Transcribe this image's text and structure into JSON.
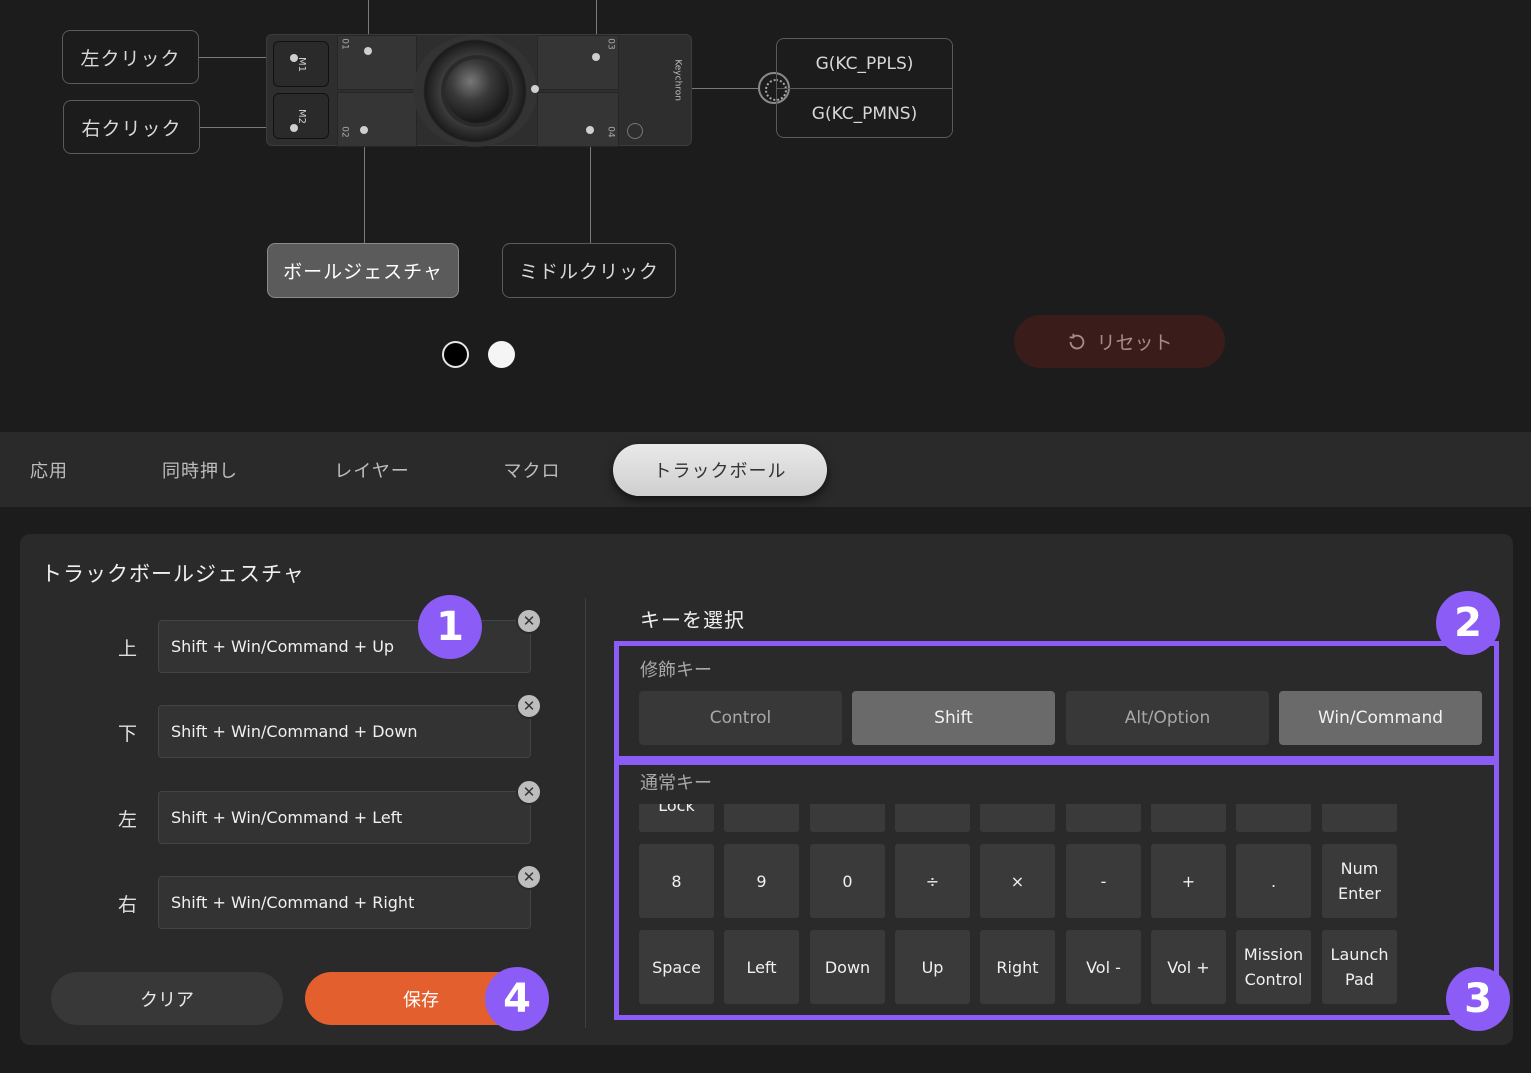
{
  "device": {
    "left_click": "左クリック",
    "right_click": "右クリック",
    "ball_gesture": "ボールジェスチャ",
    "middle_click": "ミドルクリック",
    "m1": "M1",
    "m2": "M2",
    "seg01": "01",
    "seg02": "02",
    "seg03": "03",
    "seg04": "04",
    "brand": "Keychron",
    "knob_cw": "G(KC_PPLS)",
    "knob_ccw": "G(KC_PMNS)"
  },
  "reset_label": "リセット",
  "tabs": [
    "応用",
    "同時押し",
    "レイヤー",
    "マクロ",
    "トラックボール"
  ],
  "panel": {
    "title": "トラックボールジェスチャ",
    "gestures": [
      {
        "dir": "上",
        "value": "Shift + Win/Command + Up"
      },
      {
        "dir": "下",
        "value": "Shift + Win/Command + Down"
      },
      {
        "dir": "左",
        "value": "Shift + Win/Command + Left"
      },
      {
        "dir": "右",
        "value": "Shift + Win/Command + Right"
      }
    ],
    "remove_glyph": "✕",
    "clear_label": "クリア",
    "save_label": "保存",
    "select_title": "キーを選択",
    "modifier_label": "修飾キー",
    "modifiers": [
      "Control",
      "Shift",
      "Alt/Option",
      "Win/Command"
    ],
    "normal_label": "通常キー",
    "keys_row0": [
      "Lock",
      "",
      "",
      "",
      "",
      "",
      "",
      "",
      ""
    ],
    "keys_row1": [
      "8",
      "9",
      "0",
      "÷",
      "×",
      "-",
      "+",
      ".",
      "Num Enter"
    ],
    "keys_row2": [
      "Space",
      "Left",
      "Down",
      "Up",
      "Right",
      "Vol -",
      "Vol +",
      "Mission Control",
      "Launch Pad"
    ]
  },
  "badges": [
    "1",
    "2",
    "3",
    "4"
  ],
  "colors": {
    "accent": "#8b5cf6",
    "save": "#e45f2e",
    "reset_bg": "#3a1c1a"
  }
}
